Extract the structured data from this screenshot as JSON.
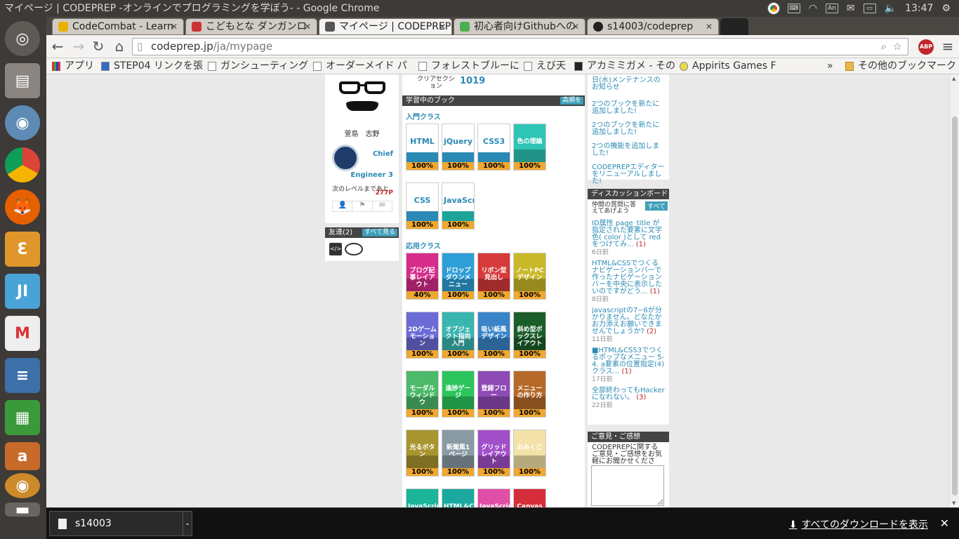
{
  "window_title": "マイページ | CODEPREP -オンラインでプログラミングを学ぼう- - Google Chrome",
  "clock": "13:47",
  "tray": {
    "ime": "An"
  },
  "tabs": [
    {
      "label": "CodeCombat - Learn",
      "color": "#e8b000"
    },
    {
      "label": "こどもとな ダンガンロ",
      "color": "#c33"
    },
    {
      "label": "マイページ | CODEPREP",
      "color": "#555"
    },
    {
      "label": "初心者向けGithubへの",
      "color": "#4caf50"
    },
    {
      "label": "s14003/codeprep",
      "color": "#222"
    }
  ],
  "url": {
    "host": "codeprep.jp",
    "path": "/ja/mypage"
  },
  "abp": "ABP",
  "bookmarks": [
    "アプリ",
    "STEP04 リンクを張",
    "ガンシューティング",
    "オーダーメイド パ",
    "フォレストブルーに",
    "えび天",
    "アカミミガメ - その",
    "Appirits Games F",
    "その他のブックマーク"
  ],
  "bookmark_overflow": "»",
  "left": {
    "name": "萱島　志野",
    "rank_label": "Chief",
    "rank_label2": "Engineer 3",
    "next_level": "次のレベルまであと",
    "next_points": "277P",
    "friends_header": "友達(2)",
    "friends_more": "すべて見る"
  },
  "center": {
    "clear_label": "クリアセクション",
    "clear_value": "1019",
    "books_header": "学習中のブック",
    "books_sort": "高順を",
    "intro_label": "入門クラス",
    "applied_label": "応用クラス",
    "intro_books": [
      {
        "title": "HTML",
        "pct": "100%",
        "bg": "#ffffff",
        "band": "#2a8ab5",
        "light": true
      },
      {
        "title": "jQuery",
        "pct": "100%",
        "bg": "#ffffff",
        "band": "#2a8ab5",
        "light": true
      },
      {
        "title": "CSS3",
        "pct": "100%",
        "bg": "#ffffff",
        "band": "#2a8ab5",
        "light": true
      },
      {
        "title": "色の理論",
        "pct": "100%",
        "bg": "#2ec4b6",
        "band": "#178f86",
        "light": false
      },
      {
        "title": "CSS",
        "pct": "100%",
        "bg": "#ffffff",
        "band": "#2a8ab5",
        "light": true
      },
      {
        "title": "JavaScript",
        "pct": "100%",
        "bg": "#ffffff",
        "band": "#1ca39a",
        "light": true
      }
    ],
    "applied_books": [
      {
        "title": "ブログ記事レイアウト",
        "pct": "40%",
        "bg": "#d62d8a"
      },
      {
        "title": "ドロップダウンメニュー",
        "pct": "100%",
        "bg": "#2e9fd6"
      },
      {
        "title": "リボン型見出し",
        "pct": "100%",
        "bg": "#d63a3a"
      },
      {
        "title": "ノートPCデザイン",
        "pct": "100%",
        "bg": "#c9b82a"
      },
      {
        "title": "2Dゲームモーション",
        "pct": "100%",
        "bg": "#6b6bd6"
      },
      {
        "title": "オブジェクト指向入門",
        "pct": "100%",
        "bg": "#3ab5b0"
      },
      {
        "title": "吸い紙風デザイン",
        "pct": "100%",
        "bg": "#3a84c9"
      },
      {
        "title": "斜め型ボックスレイアウト",
        "pct": "100%",
        "bg": "#1b5e2a"
      },
      {
        "title": "モーダルウィンドウ",
        "pct": "100%",
        "bg": "#4cba6a"
      },
      {
        "title": "進捗ゲージ",
        "pct": "100%",
        "bg": "#2cc45c"
      },
      {
        "title": "登録フロー",
        "pct": "100%",
        "bg": "#8e4bb5"
      },
      {
        "title": "メニューの作り方",
        "pct": "100%",
        "bg": "#b56a2a"
      },
      {
        "title": "光るボタン",
        "pct": "100%",
        "bg": "#a89530"
      },
      {
        "title": "新聞風1ページ",
        "pct": "100%",
        "bg": "#8a9aa3"
      },
      {
        "title": "グリッドレイアウト",
        "pct": "100%",
        "bg": "#a14fc9"
      },
      {
        "title": "おみくじ",
        "pct": "100%",
        "bg": "#f3e2a8"
      },
      {
        "title": "JavaScript",
        "pct": "",
        "bg": "#1bb59a"
      },
      {
        "title": "HTML&CSS",
        "pct": "",
        "bg": "#1aa9a0"
      },
      {
        "title": "JavaScript",
        "pct": "",
        "bg": "#e04ea8"
      },
      {
        "title": "Canvas",
        "pct": "",
        "bg": "#d62d3a"
      }
    ]
  },
  "right": {
    "news": [
      {
        "text": "日(水)メンテナンスのお知らせ"
      },
      {
        "text": "2つのブックを新たに追加しました!"
      },
      {
        "text": "2つのブックを新たに追加しました!"
      },
      {
        "text": "2つの機能を追加しました!"
      },
      {
        "text": "CODEPREPエディターをリニューアルしました!"
      }
    ],
    "discussion_header": "ディスカッションボード",
    "discussion_sub": "仲間の質問に答えてあげよう",
    "discussion_more": "すべて",
    "threads": [
      {
        "text": "ID属性 page_title が指定された要素に文字色( color )として redをつけてみ...",
        "count": "(1)",
        "date": "6日前"
      },
      {
        "text": "HTML&CSSでつくるナビゲーションバーで作ったナビゲーションバーを中央に表示したいのですがどう...",
        "count": "(1)",
        "date": "8日前"
      },
      {
        "text": "javascriptの7−6が分かりません。どなたかお力添えお願いできませんでしょうか?",
        "count": "(2)",
        "date": "11日前"
      },
      {
        "text": "■HTML&CSS3でつくるポップなメニュー 5-4. a要素の位置指定(4) クラス...",
        "count": "(1)",
        "date": "17日前"
      },
      {
        "text": "全部終わってもHackerになれない。",
        "count": "(3)",
        "date": "22日前"
      }
    ],
    "feedback_header": "ご意見・ご感想",
    "feedback_text": "CODEPREPに関するご意見・ご感想をお気軽にお聞かせください。"
  },
  "download": {
    "file": "s14003",
    "show_all": "すべてのダウンロードを表示"
  }
}
